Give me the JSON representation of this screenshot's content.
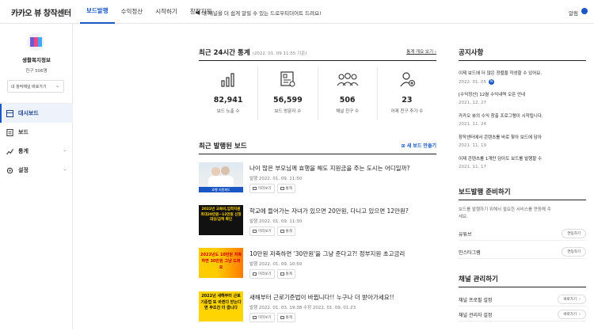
{
  "header": {
    "logo": "카카오 뷰 창작센터",
    "nav": [
      "보드발행",
      "수익정산",
      "시작하기",
      "창작지원"
    ],
    "notice": "내 채널을 더 쉽게 알릴 수 있는 드로우티더어트 드려요!",
    "alarm": "알림"
  },
  "sidebar": {
    "board_name": "생활복지정보",
    "friends": "친구 506명",
    "select_label": "내 창작채널 바로가기",
    "items": [
      {
        "label": "대시보드"
      },
      {
        "label": "보드"
      },
      {
        "label": "통계"
      },
      {
        "label": "설정"
      }
    ]
  },
  "stats": {
    "title": "최근 24시간 통계",
    "subtitle": "(2022. 01. 09 11:55 기준)",
    "link": "통계 개요 보기",
    "items": [
      {
        "value": "82,941",
        "label": "보드 노출 수",
        "icon": "bar-chart-icon"
      },
      {
        "value": "56,599",
        "label": "보드 방문자 수",
        "icon": "board-doc-icon"
      },
      {
        "value": "506",
        "label": "채널 친구 수",
        "icon": "people-icon"
      },
      {
        "value": "23",
        "label": "어제 친구 추가 수",
        "icon": "add-friend-icon"
      }
    ]
  },
  "boards": {
    "title": "최근 발행된 보드",
    "new_button": "새 보드 만들기",
    "btn_preview": "미리보기",
    "btn_stats": "통계",
    "items": [
      {
        "title": "나이 많은 부모님께 효행을 해도 지원금을 주는 도시는 어디일까?",
        "date": "발행 2022. 01. 09. 11:50",
        "thumb_text": "효행 지원제도"
      },
      {
        "title": "학교에 들어가는 자녀가 있으면 20만원, 다니고 있으면 12만원?",
        "date": "발행 2022. 01. 09. 11:30",
        "thumb_text": "2022년 교육비,입학지원 최대20만원~12만원 신청대상/금액 확인"
      },
      {
        "title": "10만원 저축하면 '30만원'을 그냥 준다고?! 정부지원 초고금리",
        "date": "발행 2022. 01. 09. 10:50",
        "thumb_text": "2022년도 10만원 저축하면 30만원 그냥 드려요"
      },
      {
        "title": "새해부터 근로기준법이 바뀝니다!! 누구나 더 받아가세요!!",
        "date": "발행 2022. 01. 03. 19:38  수정 2022. 01. 09. 01:23",
        "thumb_text": "2022년 새해부터 근로기준법 또 바뀐다 받는다면 무조건 더 줍니다"
      }
    ]
  },
  "notices": {
    "title": "공지사항",
    "items": [
      {
        "title": "이제 보드에 더 많은 정렬을 작성할 수 있어요.",
        "date": "2022. 01. 05",
        "new": "N"
      },
      {
        "title": "[수익정산] 12월 수익내역 오픈 안내",
        "date": "2021. 12. 27"
      },
      {
        "title": "카카오 뷰의 수익 창출 프로그램이 시작됩니다.",
        "date": "2021. 11. 24"
      },
      {
        "title": "창작센터에서 콘텐츠를 바로 찾아 보드에 담아",
        "date": "2021. 11. 19"
      },
      {
        "title": "이제 콘텐츠를 1개만 담아도 보드를 발행할 수",
        "date": "2021. 11. 17"
      }
    ]
  },
  "prep": {
    "title": "보드발행 준비하기",
    "desc": "보드를 발행하기 위해서 필요한 서비스를 연동해 주세요.",
    "items": [
      {
        "name": "유튜브",
        "button": "연동하기"
      },
      {
        "name": "인스타그램",
        "button": "연동하기"
      }
    ]
  },
  "channel": {
    "title": "채널 관리하기",
    "items": [
      {
        "name": "채널 프로필 설정",
        "button": "바로가기"
      },
      {
        "name": "채널 관리자 설정",
        "button": "바로가기"
      }
    ]
  },
  "colors": {
    "accent": "#1a57c4"
  }
}
